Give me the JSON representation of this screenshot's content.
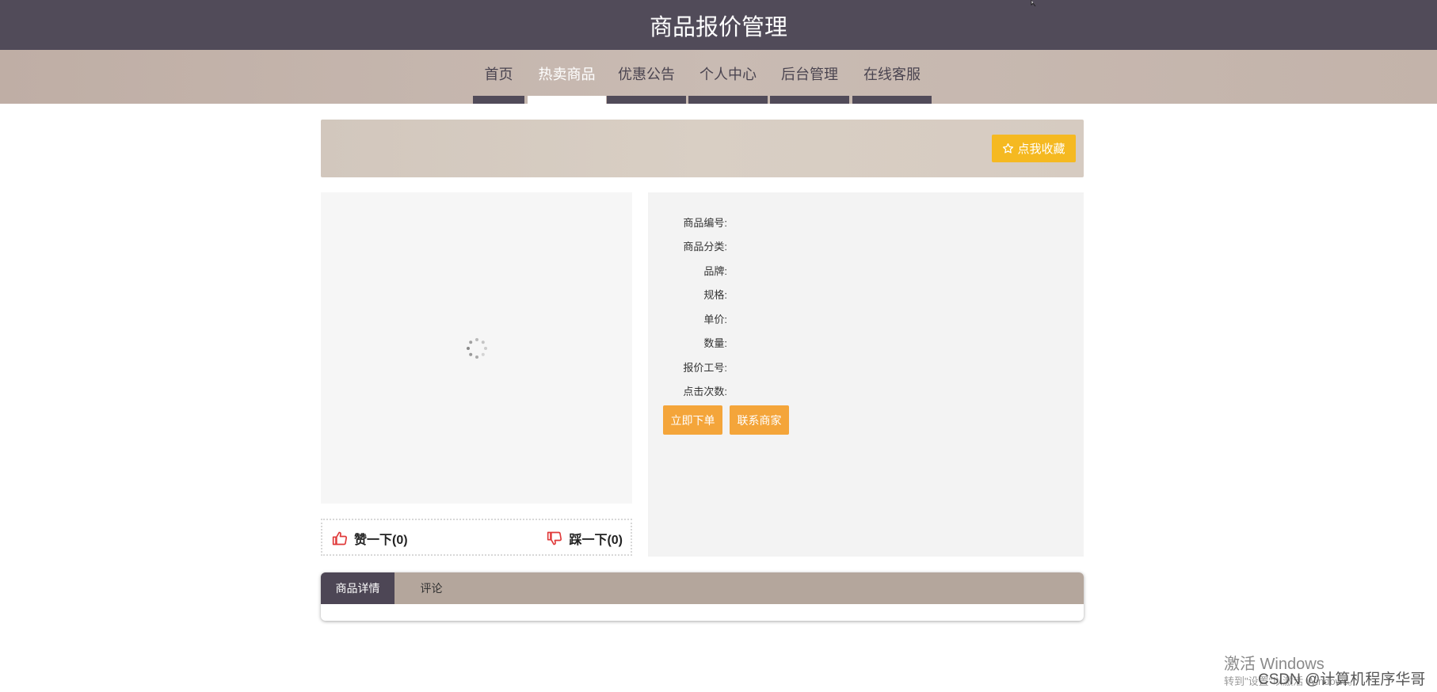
{
  "header": {
    "title": "商品报价管理"
  },
  "nav": {
    "items": [
      {
        "label": "首页",
        "active": false
      },
      {
        "label": "热卖商品",
        "active": true
      },
      {
        "label": "优惠公告",
        "active": false
      },
      {
        "label": "个人中心",
        "active": false
      },
      {
        "label": "后台管理",
        "active": false
      },
      {
        "label": "在线客服",
        "active": false
      }
    ]
  },
  "favorite": {
    "icon": "star-outline-icon",
    "label": "点我收藏"
  },
  "info": {
    "fields": [
      {
        "label": "商品编号:"
      },
      {
        "label": "商品分类:"
      },
      {
        "label": "品牌:"
      },
      {
        "label": "规格:"
      },
      {
        "label": "单价:"
      },
      {
        "label": "数量:"
      },
      {
        "label": "报价工号:"
      },
      {
        "label": "点击次数:"
      }
    ],
    "order_label": "立即下单",
    "contact_label": "联系商家"
  },
  "votes": {
    "like_label": "赞一下(0)",
    "dislike_label": "踩一下(0)"
  },
  "tabs": [
    {
      "label": "商品详情",
      "active": true
    },
    {
      "label": "评论",
      "active": false
    }
  ],
  "watermark": {
    "windows": "激活 Windows",
    "windows_sub": "转到\"设置\"以激活 Windows。",
    "csdn": "CSDN @计算机程序华哥"
  },
  "colors": {
    "header_bg": "#514b59",
    "nav_bg": "#c3b3aa",
    "favorite_btn": "#f5b921",
    "action_btn": "#f4a53a",
    "vote_icon": "#e03a3a"
  }
}
